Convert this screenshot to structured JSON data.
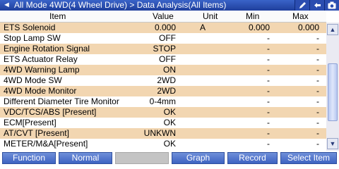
{
  "titlebar": {
    "back_glyph": "◄",
    "title": "All Mode 4WD(4 Wheel Drive) > Data Analysis(All Items)",
    "icons": [
      "pen-icon",
      "back-arrow-icon",
      "camera-icon"
    ]
  },
  "columns": {
    "item": "Item",
    "value": "Value",
    "unit": "Unit",
    "min": "Min",
    "max": "Max"
  },
  "rows": [
    {
      "item": "ETS Solenoid",
      "value": "0.000",
      "unit": "A",
      "min": "0.000",
      "max": "0.000"
    },
    {
      "item": "Stop Lamp SW",
      "value": "OFF",
      "unit": "",
      "min": "-",
      "max": "-"
    },
    {
      "item": "Engine Rotation Signal",
      "value": "STOP",
      "unit": "",
      "min": "-",
      "max": "-"
    },
    {
      "item": "ETS Actuator Relay",
      "value": "OFF",
      "unit": "",
      "min": "-",
      "max": "-"
    },
    {
      "item": "4WD Warning Lamp",
      "value": "ON",
      "unit": "",
      "min": "-",
      "max": "-"
    },
    {
      "item": "4WD Mode SW",
      "value": "2WD",
      "unit": "",
      "min": "-",
      "max": "-"
    },
    {
      "item": "4WD Mode Monitor",
      "value": "2WD",
      "unit": "",
      "min": "-",
      "max": "-"
    },
    {
      "item": "Different Diameter Tire Monitor",
      "value": "0-4mm",
      "unit": "",
      "min": "-",
      "max": "-"
    },
    {
      "item": "VDC/TCS/ABS [Present]",
      "value": "OK",
      "unit": "",
      "min": "-",
      "max": "-"
    },
    {
      "item": "ECM[Present]",
      "value": "OK",
      "unit": "",
      "min": "-",
      "max": "-"
    },
    {
      "item": "AT/CVT [Present]",
      "value": "UNKWN",
      "unit": "",
      "min": "-",
      "max": "-"
    },
    {
      "item": "METER/M&A[Present]",
      "value": "OK",
      "unit": "",
      "min": "-",
      "max": "-"
    }
  ],
  "scrollbar": {
    "up": "▲",
    "down": "▼"
  },
  "buttons": {
    "function": "Function",
    "normal": "Normal",
    "blank": "",
    "graph": "Graph",
    "record": "Record",
    "select_item": "Select Item"
  }
}
